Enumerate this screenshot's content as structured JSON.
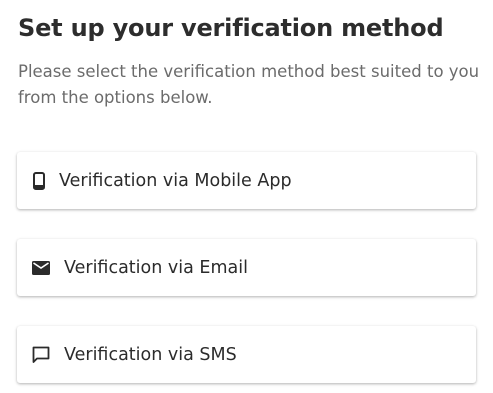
{
  "header": {
    "title": "Set up your verification method",
    "subtitle": "Please select the verification method best suited to you from the options below."
  },
  "options": [
    {
      "label": "Verification via Mobile App",
      "icon": "smartphone-icon"
    },
    {
      "label": "Verification via Email",
      "icon": "mail-icon"
    },
    {
      "label": "Verification via SMS",
      "icon": "chat-bubble-icon"
    }
  ],
  "colors": {
    "title": "#2d2d2d",
    "subtitle": "#6b6b6b",
    "icon": "#2b2b2b",
    "card_background": "#ffffff"
  }
}
